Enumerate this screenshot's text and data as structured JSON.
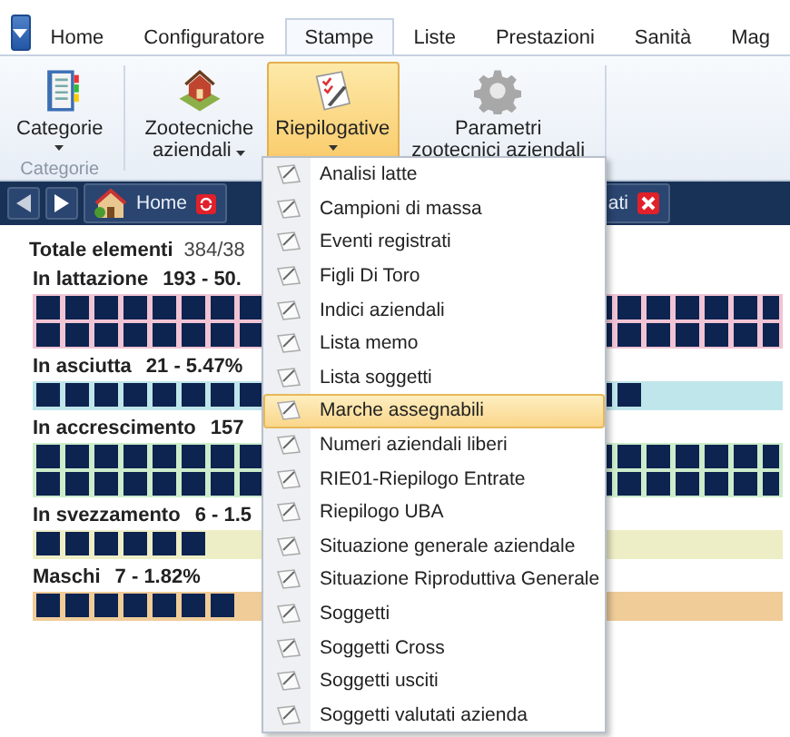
{
  "ribbon_tabs": [
    {
      "label": "Home",
      "selected": false
    },
    {
      "label": "Configuratore",
      "selected": false
    },
    {
      "label": "Stampe",
      "selected": true
    },
    {
      "label": "Liste",
      "selected": false
    },
    {
      "label": "Prestazioni",
      "selected": false
    },
    {
      "label": "Sanità",
      "selected": false
    },
    {
      "label": "Mag",
      "selected": false
    }
  ],
  "ribbon_groups": [
    {
      "label": "Categorie",
      "buttons": [
        {
          "kind": "notebook",
          "lines": [
            "Categorie"
          ],
          "dropdown": true,
          "selected": false
        }
      ]
    },
    {
      "buttons": [
        {
          "kind": "barn",
          "lines": [
            "Zootecniche",
            "aziendali"
          ],
          "dropdown": true,
          "selected": false
        },
        {
          "kind": "checklist",
          "lines": [
            "Riepilogative"
          ],
          "dropdown": true,
          "selected": true
        },
        {
          "kind": "gear",
          "lines": [
            "Parametri",
            "zootecnici aziendali"
          ],
          "dropdown": false,
          "selected": false
        }
      ]
    }
  ],
  "nav_tabs": [
    {
      "label": "Home",
      "kind": "home"
    },
    {
      "label": "ati",
      "kind": "doc"
    }
  ],
  "totale": {
    "label": "Totale elementi",
    "value": "384/38"
  },
  "groups": [
    {
      "label": "In lattazione",
      "value": "193 - 50.",
      "color": "#f0c4d4",
      "rows": [
        {
          "level": 1
        },
        {
          "level": 1
        }
      ]
    },
    {
      "label": "In asciutta",
      "value": "21 - 5.47%",
      "color": "#bfe6ea",
      "rows": [
        {
          "level": 0.81
        }
      ]
    },
    {
      "label": "In accrescimento",
      "value": "157",
      "color": "#cdeccb",
      "rows": [
        {
          "level": 1
        },
        {
          "level": 1
        }
      ]
    },
    {
      "label": "In svezzamento",
      "value": "6 - 1.5",
      "color": "#eeeec6",
      "rows": [
        {
          "level": 0.24
        }
      ]
    },
    {
      "label": "Maschi",
      "value": "7 - 1.82%",
      "color": "#f0cc98",
      "rows": [
        {
          "level": 0.28
        }
      ]
    }
  ],
  "menu": [
    {
      "label": "Analisi latte",
      "selected": false
    },
    {
      "label": "Campioni di massa",
      "selected": false
    },
    {
      "label": "Eventi registrati",
      "selected": false
    },
    {
      "label": "Figli Di Toro",
      "selected": false
    },
    {
      "label": "Indici aziendali",
      "selected": false
    },
    {
      "label": "Lista memo",
      "selected": false
    },
    {
      "label": "Lista soggetti",
      "selected": false
    },
    {
      "label": "Marche assegnabili",
      "selected": true
    },
    {
      "label": "Numeri aziendali liberi",
      "selected": false
    },
    {
      "label": "RIE01-Riepilogo Entrate",
      "selected": false
    },
    {
      "label": "Riepilogo UBA",
      "selected": false
    },
    {
      "label": "Situazione generale aziendale",
      "selected": false
    },
    {
      "label": "Situazione Riproduttiva Generale",
      "selected": false
    },
    {
      "label": "Soggetti",
      "selected": false
    },
    {
      "label": "Soggetti Cross",
      "selected": false
    },
    {
      "label": "Soggetti usciti",
      "selected": false
    },
    {
      "label": "Soggetti valutati azienda",
      "selected": false
    }
  ]
}
